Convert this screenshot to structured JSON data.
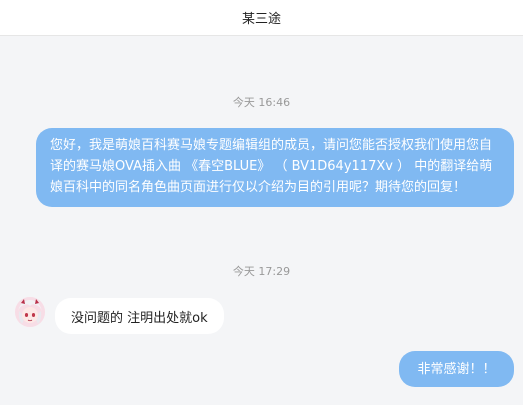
{
  "header": {
    "title": "某三途"
  },
  "messages": {
    "timestamp_1": "今天 16:46",
    "outgoing_1": "您好，我是萌娘百科赛马娘专题编辑组的成员，请问您能否授权我们使用您自译的赛马娘OVA插入曲 《春空BLUE》 （ BV1D64y117Xv ） 中的翻译给萌娘百科中的同名角色曲页面进行仅以介绍为目的引用呢？期待您的回复！",
    "timestamp_2": "今天 17:29",
    "incoming_1": "没问题的 注明出处就ok",
    "outgoing_2": "非常感谢！！"
  },
  "colors": {
    "outgoing_bubble": "#80b9f2",
    "incoming_bubble": "#ffffff",
    "background": "#f4f5f7"
  }
}
